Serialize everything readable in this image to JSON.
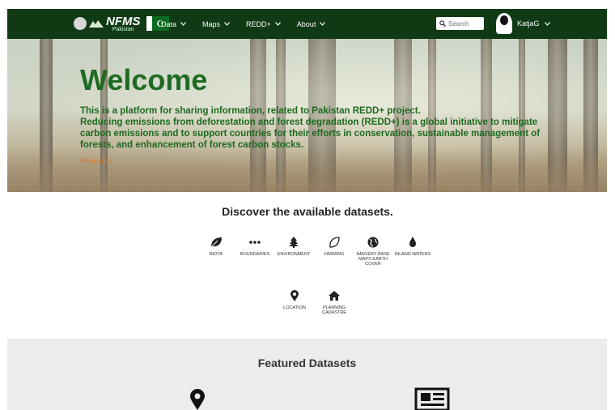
{
  "navbar": {
    "brand": "NFMS",
    "brand_sub": "Pakistan",
    "menu": [
      {
        "label": "Data"
      },
      {
        "label": "Maps"
      },
      {
        "label": "REDD+"
      },
      {
        "label": "About"
      }
    ],
    "search_placeholder": "Search",
    "user_name": "KatjaG",
    "colors": {
      "bar": "#0f3a14"
    }
  },
  "hero": {
    "title": "Welcome",
    "line1": "This is a platform for sharing information, related to Pakistan REDD+ project.",
    "line2": "Reducing emissions from deforestation and forest degradation (REDD+) is a global initiative to mitigate carbon emissions and to support countries for their efforts in conservation, sustainable management of forests, and enhancement of forest carbon stocks.",
    "read_more": "Read more"
  },
  "discover": {
    "title": "Discover the available datasets.",
    "categories": [
      {
        "label": "BIOTA",
        "icon": "leaf-icon"
      },
      {
        "label": "BOUNDARIES",
        "icon": "ellipsis-icon"
      },
      {
        "label": "ENVIRONMENT",
        "icon": "tree-icon"
      },
      {
        "label": "FARMING",
        "icon": "blank-leaf-icon"
      },
      {
        "label": "IMAGERY BASE MAPS EARTH COVER",
        "icon": "globe-icon"
      },
      {
        "label": "INLAND WATERS",
        "icon": "drop-icon"
      },
      {
        "label": "LOCATION",
        "icon": "map-marker-icon"
      },
      {
        "label": "PLANNING CADASTRE",
        "icon": "home-icon"
      }
    ]
  },
  "featured": {
    "title": "Featured Datasets",
    "icons": [
      "map-marker-icon",
      "newspaper-icon"
    ],
    "background": "#ececec"
  }
}
